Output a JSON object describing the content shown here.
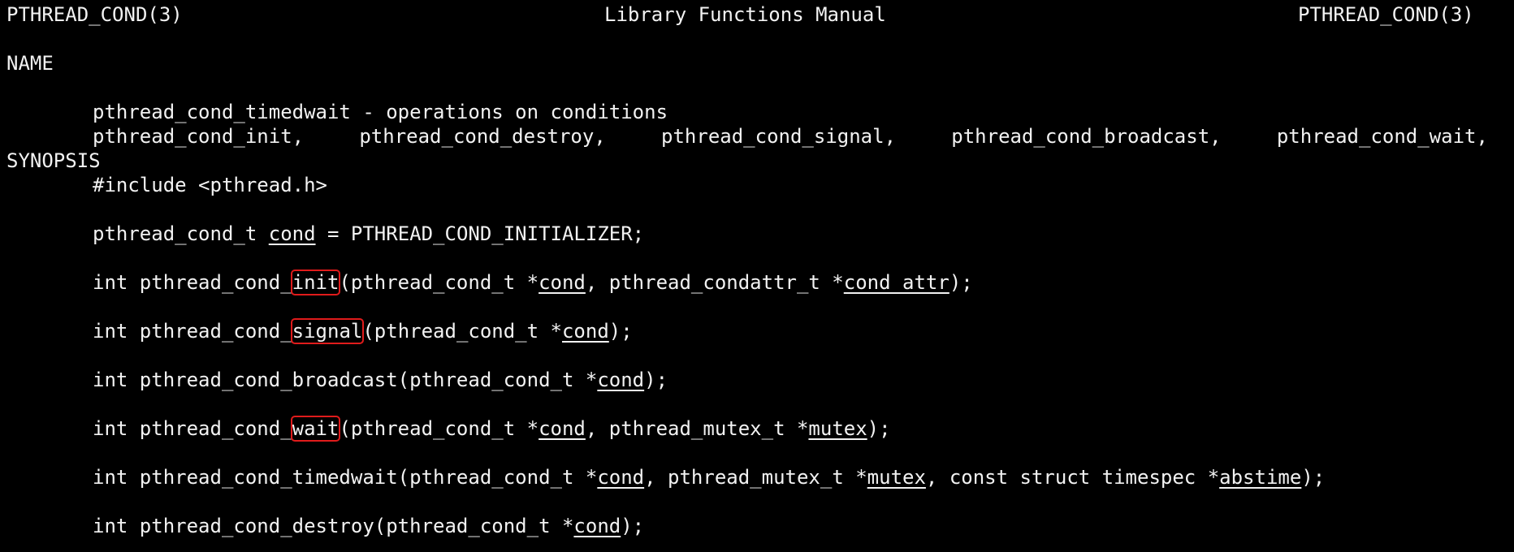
{
  "header": {
    "left": "PTHREAD_COND(3)",
    "center": "Library Functions Manual",
    "right": "PTHREAD_COND(3)"
  },
  "name": {
    "heading": "NAME",
    "funcs": [
      "pthread_cond_init,",
      "pthread_cond_destroy,",
      "pthread_cond_signal,",
      "pthread_cond_broadcast,",
      "pthread_cond_wait,"
    ],
    "line2": "pthread_cond_timedwait - operations on conditions"
  },
  "synopsis": {
    "heading": "SYNOPSIS",
    "include": "#include <pthread.h>",
    "initializer": {
      "pre": "pthread_cond_t ",
      "var": "cond",
      "post": " = PTHREAD_COND_INITIALIZER;"
    },
    "init": {
      "pre": "int pthread_cond_",
      "hl": "init",
      "a": "(pthread_cond_t *",
      "arg1": "cond",
      "b": ", pthread_condattr_t *",
      "arg2": "cond_attr",
      "end": ");"
    },
    "signal": {
      "pre": "int pthread_cond_",
      "hl": "signal",
      "a": "(pthread_cond_t *",
      "arg1": "cond",
      "end": ");"
    },
    "broadcast": {
      "pre": "int pthread_cond_broadcast(pthread_cond_t *",
      "arg1": "cond",
      "end": ");"
    },
    "wait": {
      "pre": "int pthread_cond_",
      "hl": "wait",
      "a": "(pthread_cond_t *",
      "arg1": "cond",
      "b": ", pthread_mutex_t *",
      "arg2": "mutex",
      "end": ");"
    },
    "timedwait": {
      "pre": "int pthread_cond_timedwait(pthread_cond_t *",
      "arg1": "cond",
      "b": ", pthread_mutex_t *",
      "arg2": "mutex",
      "c": ", const struct timespec *",
      "arg3": "abstime",
      "end": ");"
    },
    "destroy": {
      "pre": "int pthread_cond_destroy(pthread_cond_t *",
      "arg1": "cond",
      "end": ");"
    }
  },
  "colors": {
    "background": "#000000",
    "text": "#f2f2f2",
    "highlight": "#e01b1b"
  }
}
